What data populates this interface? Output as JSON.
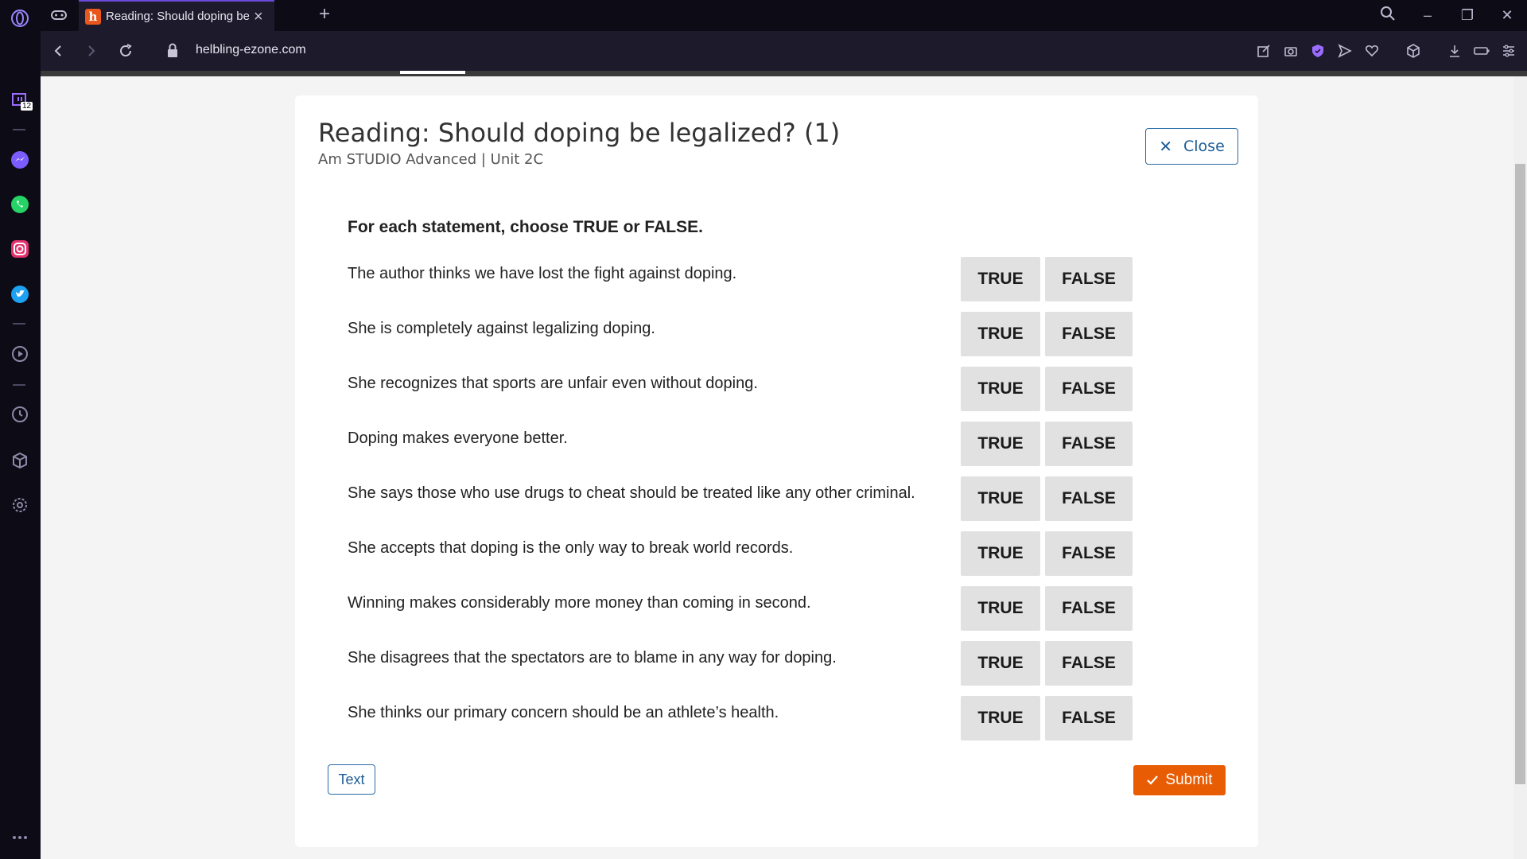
{
  "browser": {
    "tab_title": "Reading: Should doping be legalized? (1)",
    "tab_favicon_letter": "h",
    "url": "helbling-ezone.com",
    "sidebar_badge": "12"
  },
  "card": {
    "title": "Reading: Should doping be legalized? (1)",
    "subtitle": "Am STUDIO Advanced | Unit 2C",
    "close_label": "Close",
    "instruction": "For each statement, choose TRUE or FALSE.",
    "true_label": "TRUE",
    "false_label": "FALSE",
    "statements": [
      "The author thinks we have lost the fight against doping.",
      "She is completely against legalizing doping.",
      "She recognizes that sports are unfair even without doping.",
      "Doping makes everyone better.",
      "She says those who use drugs to cheat should be treated like any other criminal.",
      "She accepts that doping is the only way to break world records.",
      "Winning makes considerably more money than coming in second.",
      "She disagrees that the spectators are to blame in any way for doping.",
      "She thinks our primary concern should be an athlete’s health."
    ],
    "text_button_label": "Text",
    "submit_label": "Submit"
  },
  "colors": {
    "accent_blue": "#1d5d97",
    "submit_orange": "#e85d04",
    "option_gray": "#e1e1e1",
    "browser_dark": "#0d0c16"
  }
}
